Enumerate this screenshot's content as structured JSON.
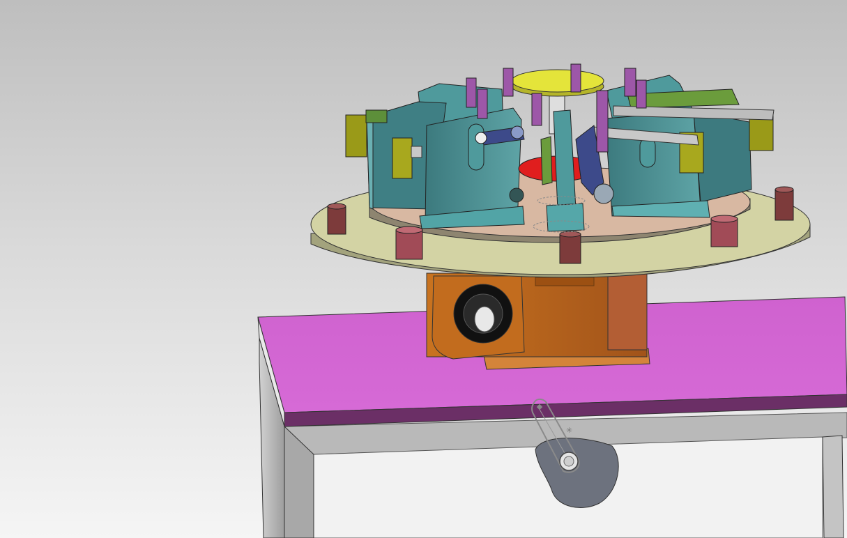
{
  "viewport": {
    "background_top": "#bebebe",
    "background_bottom": "#f5f5f5"
  },
  "model": {
    "table_top_color": "#d266d2",
    "table_edge_color": "#6b2f66",
    "table_frame_color": "#b5b5b5",
    "turntable_color": "#d3d3a4",
    "inner_plate_color": "#d8b8a2",
    "gearbox_color": "#b9611d",
    "fixture_color": "#4d8f8f",
    "cap_color": "#e4e43a",
    "clamp_color": "#a09a18",
    "post_color": "#9d57a8",
    "block_color": "#7d3b3b",
    "red_disc_color": "#e01e1e",
    "cam_color": "#6d727e"
  }
}
